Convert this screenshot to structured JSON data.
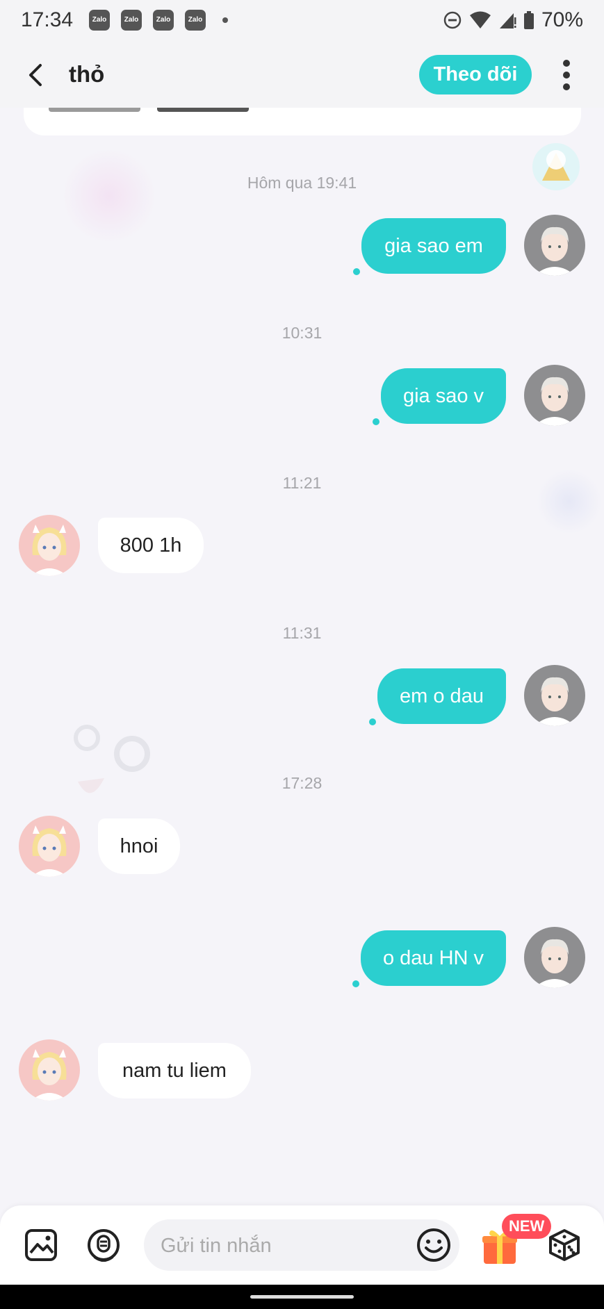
{
  "status_bar": {
    "time": "17:34",
    "notification_apps": [
      "Zalo",
      "Zalo",
      "Zalo",
      "Zalo"
    ],
    "battery": "70%"
  },
  "header": {
    "title": "thỏ",
    "follow_label": "Theo dõi"
  },
  "messages": [
    {
      "type": "time",
      "text": "Hôm qua 19:41"
    },
    {
      "type": "outgoing",
      "text": "gia sao em"
    },
    {
      "type": "time",
      "text": "10:31"
    },
    {
      "type": "outgoing",
      "text": "gia sao v"
    },
    {
      "type": "time",
      "text": "11:21"
    },
    {
      "type": "incoming",
      "text": "800 1h"
    },
    {
      "type": "time",
      "text": "11:31"
    },
    {
      "type": "outgoing",
      "text": "em o dau"
    },
    {
      "type": "time",
      "text": "17:28"
    },
    {
      "type": "incoming",
      "text": "hnoi"
    },
    {
      "type": "outgoing",
      "text": "o dau HN v"
    },
    {
      "type": "incoming",
      "text": "nam tu liem"
    }
  ],
  "composer": {
    "placeholder": "Gửi tin nhắn",
    "new_badge": "NEW"
  },
  "colors": {
    "accent": "#2bcfcf",
    "background": "#f5f4f9",
    "badge": "#ff4d5a"
  },
  "icons": [
    "back-arrow-icon",
    "more-vertical-icon",
    "image-icon",
    "voice-icon",
    "emoji-icon",
    "gift-icon",
    "dice-icon"
  ]
}
